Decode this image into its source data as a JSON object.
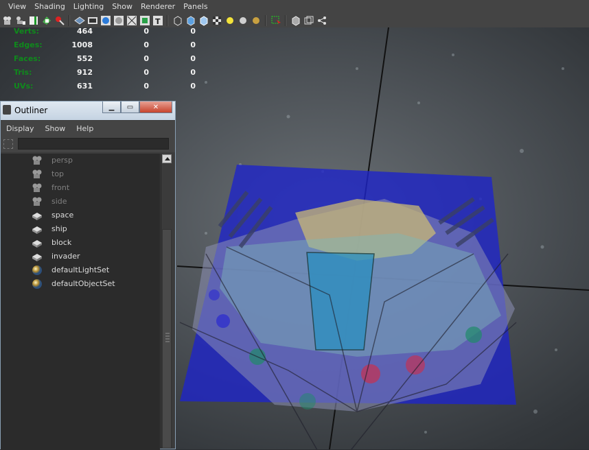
{
  "menubar": {
    "items": [
      "View",
      "Shading",
      "Lighting",
      "Show",
      "Renderer",
      "Panels"
    ]
  },
  "toolbar": {
    "icons": [
      "camera-icon",
      "camera-attr-icon",
      "bookmark-icon",
      "image-plane-icon",
      "2d-pan-icon",
      "grid-icon",
      "film-gate-icon",
      "resolution-gate-icon",
      "gate-mask-icon",
      "field-chart-icon",
      "safe-action-icon",
      "safe-title-icon",
      "wireframe-icon",
      "smooth-shade-icon",
      "shade-wireframe-icon",
      "textured-icon",
      "use-all-lights-icon",
      "shadows-icon",
      "ambient-occlusion-icon",
      "xray-icon",
      "isolate-select-icon",
      "xray-joints-icon",
      "component-xray-icon",
      "hypergraph-icon"
    ]
  },
  "hud": {
    "rows": [
      {
        "label": "Verts:",
        "v1": "464",
        "v2": "0",
        "v3": "0"
      },
      {
        "label": "Edges:",
        "v1": "1008",
        "v2": "0",
        "v3": "0"
      },
      {
        "label": "Faces:",
        "v1": "552",
        "v2": "0",
        "v3": "0"
      },
      {
        "label": "Tris:",
        "v1": "912",
        "v2": "0",
        "v3": "0"
      },
      {
        "label": "UVs:",
        "v1": "631",
        "v2": "0",
        "v3": "0"
      }
    ]
  },
  "outliner": {
    "title": "Outliner",
    "menu": [
      "Display",
      "Show",
      "Help"
    ],
    "filter_value": "",
    "items": [
      {
        "label": "persp",
        "icon": "camera-icon",
        "dim": true
      },
      {
        "label": "top",
        "icon": "camera-icon",
        "dim": true
      },
      {
        "label": "front",
        "icon": "camera-icon",
        "dim": true
      },
      {
        "label": "side",
        "icon": "camera-icon",
        "dim": true
      },
      {
        "label": "space",
        "icon": "mesh-transform-icon",
        "dim": false
      },
      {
        "label": "ship",
        "icon": "mesh-transform-icon",
        "dim": false
      },
      {
        "label": "block",
        "icon": "mesh-transform-icon",
        "dim": false
      },
      {
        "label": "invader",
        "icon": "mesh-transform-icon",
        "dim": false
      },
      {
        "label": "defaultLightSet",
        "icon": "set-sphere-icon",
        "dim": false
      },
      {
        "label": "defaultObjectSet",
        "icon": "set-sphere-icon",
        "dim": false
      }
    ]
  }
}
